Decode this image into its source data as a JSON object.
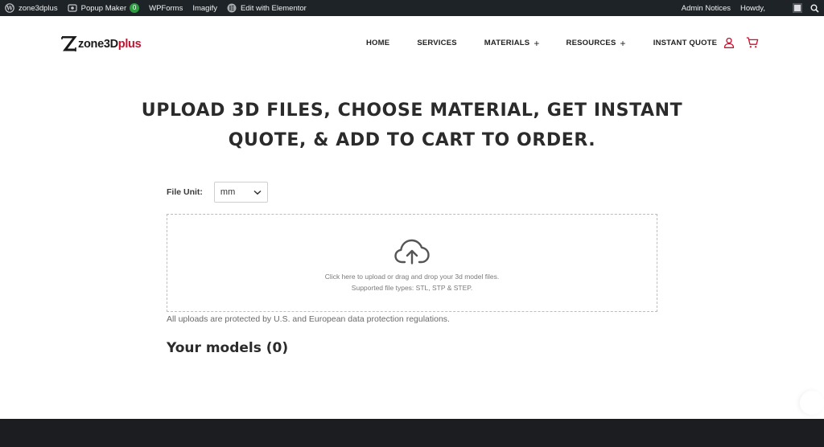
{
  "admin_bar": {
    "items": [
      {
        "label": "zone3dplus",
        "icon": "wordpress-icon"
      },
      {
        "label": "Popup Maker",
        "icon": "popup-maker-icon",
        "badge": "0"
      },
      {
        "label": "WPForms"
      },
      {
        "label": "Imagify"
      },
      {
        "label": "Edit with Elementor",
        "icon": "elementor-icon"
      }
    ],
    "admin_notices": "Admin Notices",
    "howdy": "Howdy,",
    "badge_color": "#2e9b41"
  },
  "header": {
    "logo": {
      "text_main": "zone3D",
      "text_accent": "plus",
      "accent_color": "#c8102e"
    },
    "nav": [
      {
        "label": "HOME",
        "has_submenu": false
      },
      {
        "label": "SERVICES",
        "has_submenu": false
      },
      {
        "label": "MATERIALS",
        "has_submenu": true
      },
      {
        "label": "RESOURCES",
        "has_submenu": true
      },
      {
        "label": "INSTANT QUOTE",
        "has_submenu": false
      }
    ],
    "icons": [
      "user-icon",
      "cart-icon"
    ],
    "icon_color": "#c8102e"
  },
  "main": {
    "headline_line1": "UPLOAD 3D FILES, CHOOSE MATERIAL, GET INSTANT",
    "headline_line2": "QUOTE, & ADD TO CART TO ORDER.",
    "file_unit_label": "File Unit:",
    "file_unit_value": "mm",
    "dropzone_line1": "Click here to upload or drag and drop your 3d model files.",
    "dropzone_line2": "Supported file types: STL, STP & STEP.",
    "protection_note": "All uploads are protected by U.S. and European data protection regulations.",
    "models_heading": "Your models (0)"
  }
}
